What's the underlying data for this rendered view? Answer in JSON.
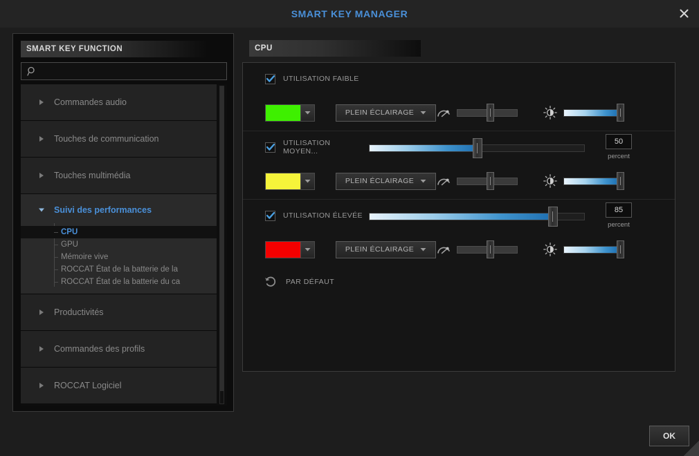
{
  "window": {
    "title": "SMART KEY MANAGER",
    "close_icon": "close-icon",
    "accent_color": "#4a90d9"
  },
  "sidebar": {
    "header": "SMART KEY FUNCTION",
    "search": {
      "value": "",
      "placeholder": "",
      "icon": "search-icon"
    },
    "groups": [
      {
        "label": "Commandes audio",
        "expanded": false,
        "children": []
      },
      {
        "label": "Touches de communication",
        "expanded": false,
        "children": []
      },
      {
        "label": "Touches multimédia",
        "expanded": false,
        "children": []
      },
      {
        "label": "Suivi des performances",
        "expanded": true,
        "children": [
          {
            "label": "CPU",
            "active": true
          },
          {
            "label": "GPU",
            "active": false
          },
          {
            "label": "Mémoire vive",
            "active": false
          },
          {
            "label": "ROCCAT État de la batterie de la",
            "active": false
          },
          {
            "label": "ROCCAT État de la batterie du ca",
            "active": false
          }
        ]
      },
      {
        "label": "Productivités",
        "expanded": false,
        "children": []
      },
      {
        "label": "Commandes des profils",
        "expanded": false,
        "children": []
      },
      {
        "label": "ROCCAT Logiciel",
        "expanded": false,
        "children": []
      }
    ]
  },
  "main": {
    "header": "CPU",
    "blocks": [
      {
        "checkbox_label": "UTILISATION FAIBLE",
        "checked": true,
        "has_threshold": false,
        "threshold_percent": null,
        "threshold_unit": null,
        "color": "#3ef000",
        "color_name": "green",
        "effect": "PLEIN ÉCLAIRAGE",
        "speed_icon": "speed-gauge-icon",
        "speed_percent": 52,
        "brightness_icon": "brightness-icon",
        "brightness_percent": 100
      },
      {
        "checkbox_label": "UTILISATION MOYEN...",
        "checked": true,
        "has_threshold": true,
        "threshold_percent": 50,
        "threshold_unit": "percent",
        "color": "#f5f43a",
        "color_name": "yellow",
        "effect": "PLEIN ÉCLAIRAGE",
        "speed_icon": "speed-gauge-icon",
        "speed_percent": 52,
        "brightness_icon": "brightness-icon",
        "brightness_percent": 100
      },
      {
        "checkbox_label": "UTILISATION ÉLEVÉE",
        "checked": true,
        "has_threshold": true,
        "threshold_percent": 85,
        "threshold_unit": "percent",
        "color": "#f40000",
        "color_name": "red",
        "effect": "PLEIN ÉCLAIRAGE",
        "speed_icon": "speed-gauge-icon",
        "speed_percent": 52,
        "brightness_icon": "brightness-icon",
        "brightness_percent": 100
      }
    ],
    "default_button": {
      "label": "PAR DÉFAUT",
      "icon": "reset-arrow-icon"
    }
  },
  "footer": {
    "ok_label": "OK"
  }
}
